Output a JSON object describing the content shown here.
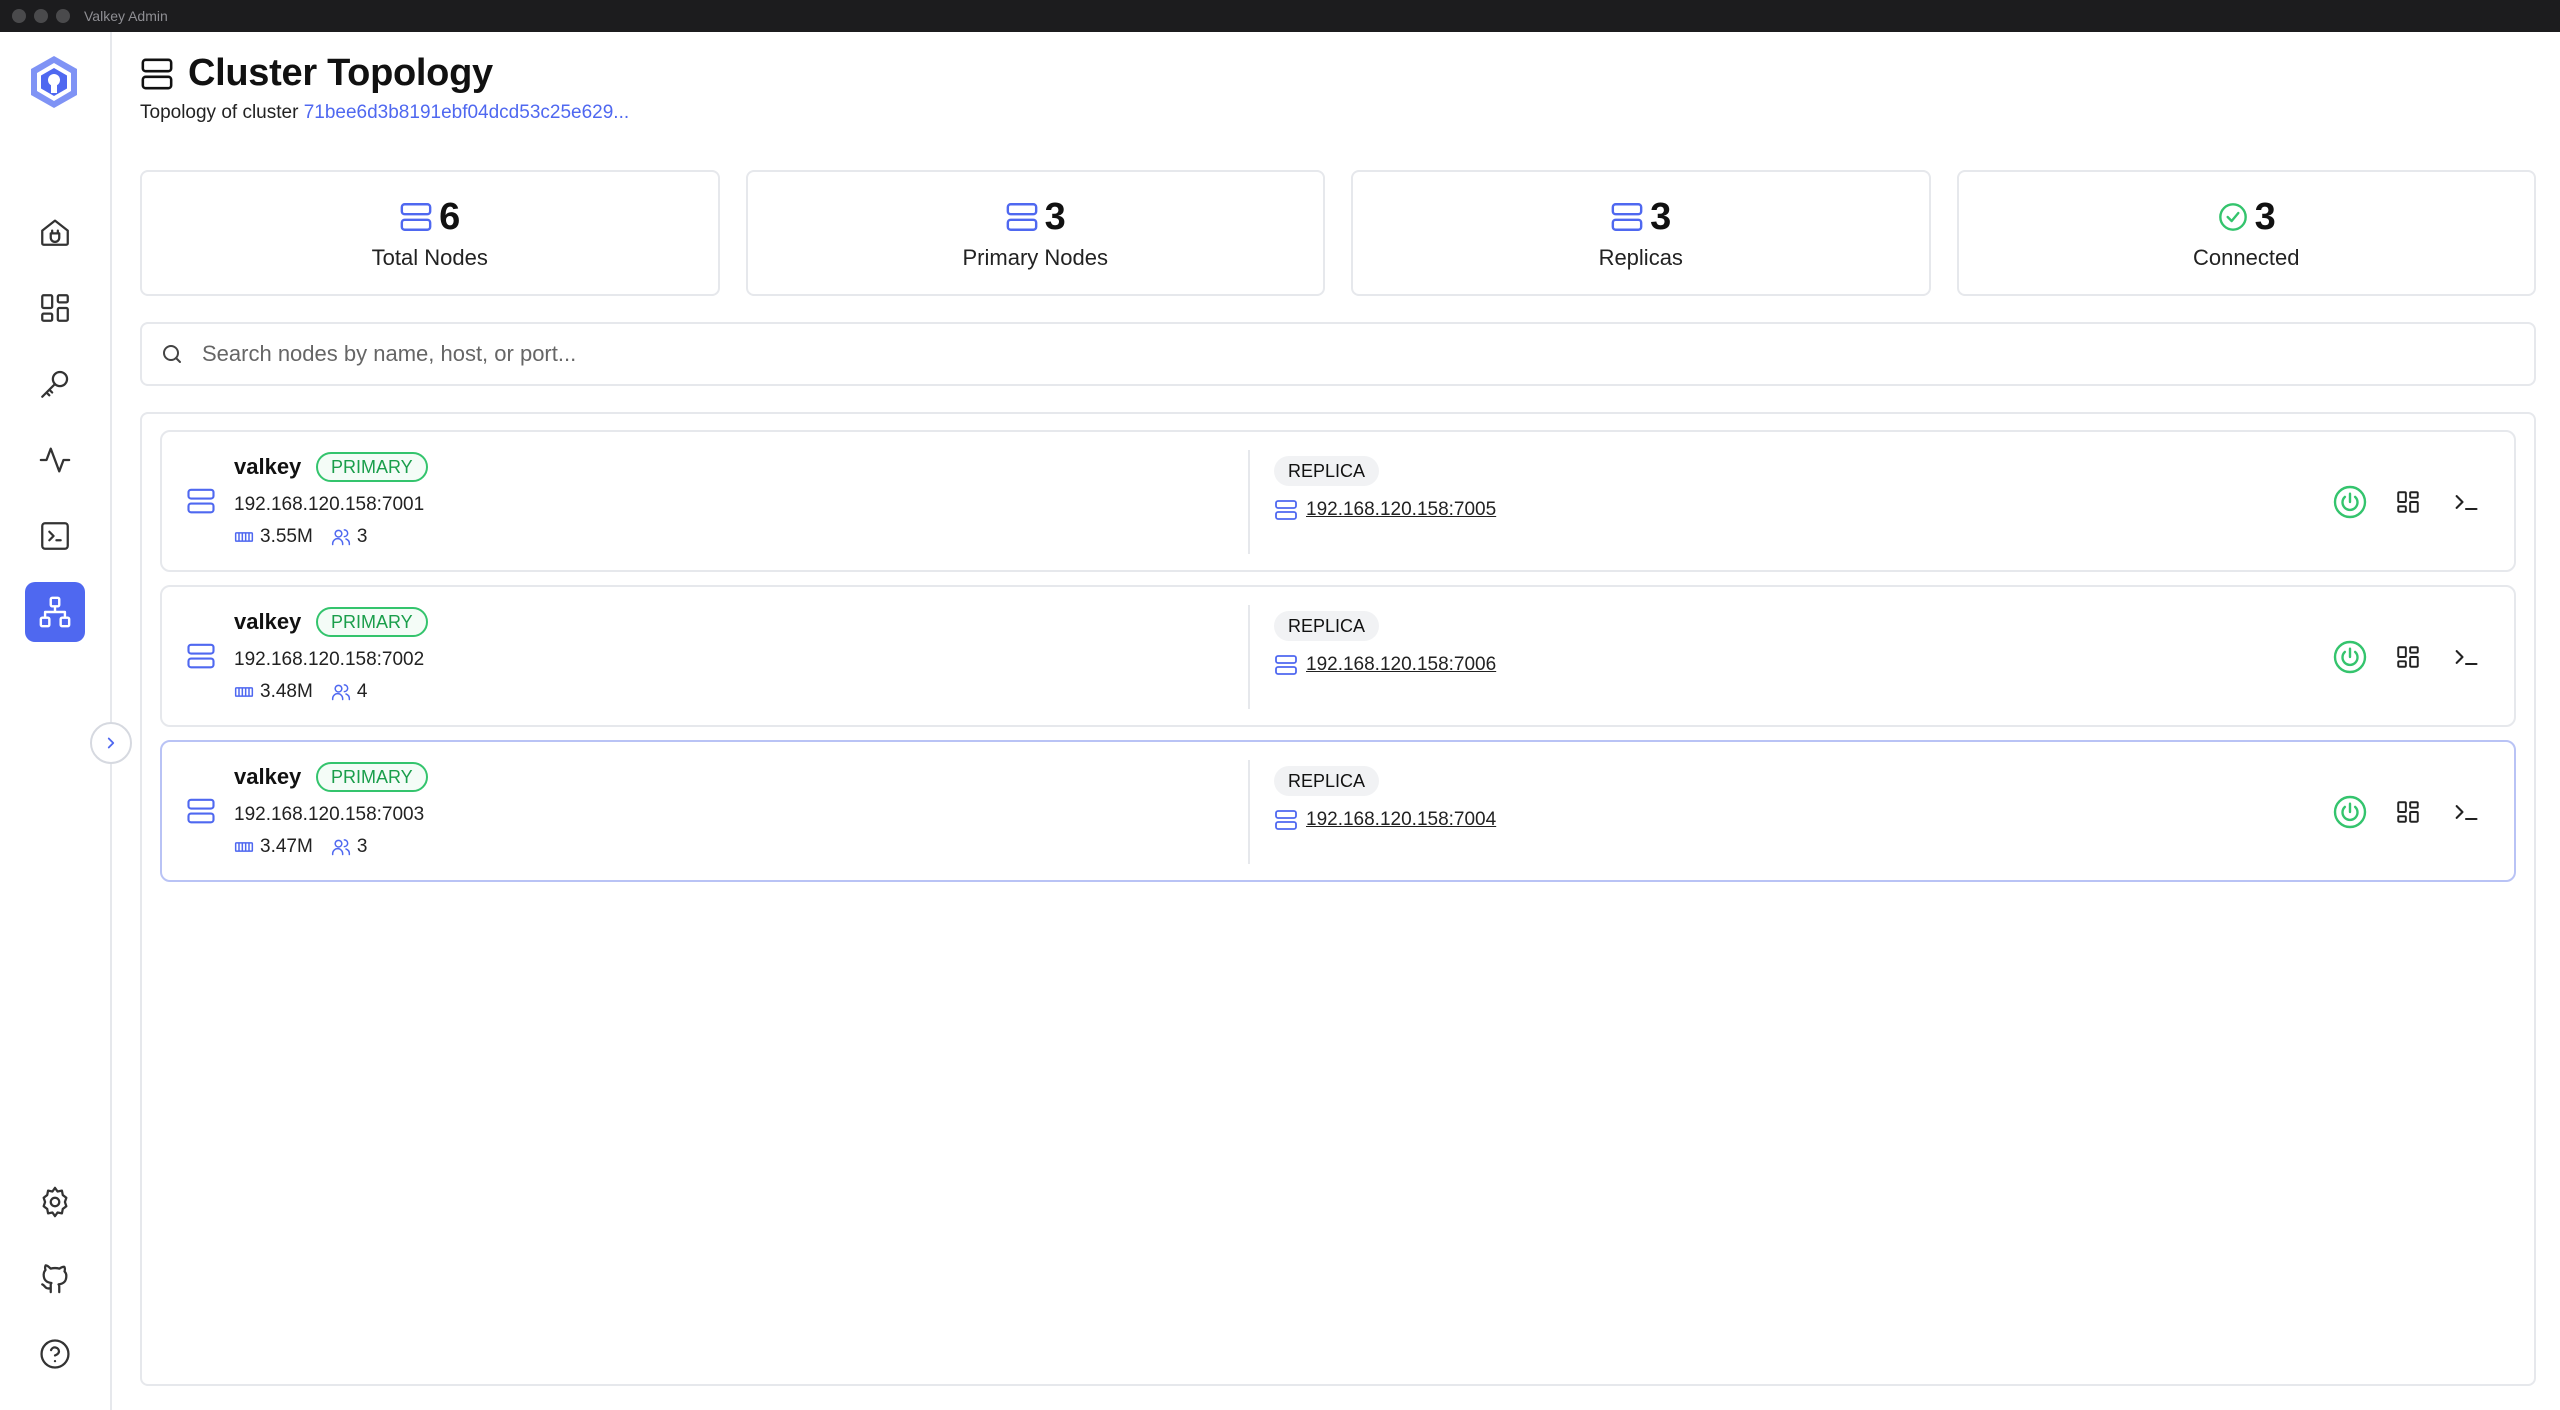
{
  "window": {
    "title": "Valkey Admin"
  },
  "header": {
    "title": "Cluster Topology",
    "subtitle_prefix": "Topology of cluster",
    "cluster_id": "71bee6d3b8191ebf04dcd53c25e629..."
  },
  "stats": [
    {
      "value": "6",
      "label": "Total Nodes",
      "icon": "server-icon"
    },
    {
      "value": "3",
      "label": "Primary Nodes",
      "icon": "server-icon"
    },
    {
      "value": "3",
      "label": "Replicas",
      "icon": "server-icon"
    },
    {
      "value": "3",
      "label": "Connected",
      "icon": "check-circle-icon"
    }
  ],
  "search": {
    "placeholder": "Search nodes by name, host, or port..."
  },
  "nodes": [
    {
      "name": "valkey",
      "role": "PRIMARY",
      "address": "192.168.120.158:7001",
      "memory": "3.55M",
      "clients": "3",
      "replica_label": "REPLICA",
      "replica_address": "192.168.120.158:7005"
    },
    {
      "name": "valkey",
      "role": "PRIMARY",
      "address": "192.168.120.158:7002",
      "memory": "3.48M",
      "clients": "4",
      "replica_label": "REPLICA",
      "replica_address": "192.168.120.158:7006"
    },
    {
      "name": "valkey",
      "role": "PRIMARY",
      "address": "192.168.120.158:7003",
      "memory": "3.47M",
      "clients": "3",
      "replica_label": "REPLICA",
      "replica_address": "192.168.120.158:7004"
    }
  ],
  "sidebar": {
    "items": [
      "home-icon",
      "dashboard-icon",
      "key-icon",
      "activity-icon",
      "terminal-icon",
      "topology-icon"
    ],
    "active": "topology-icon",
    "bottom": [
      "settings-icon",
      "github-icon",
      "help-icon"
    ]
  },
  "colors": {
    "accent": "#4f68f0",
    "success": "#34c46d"
  }
}
